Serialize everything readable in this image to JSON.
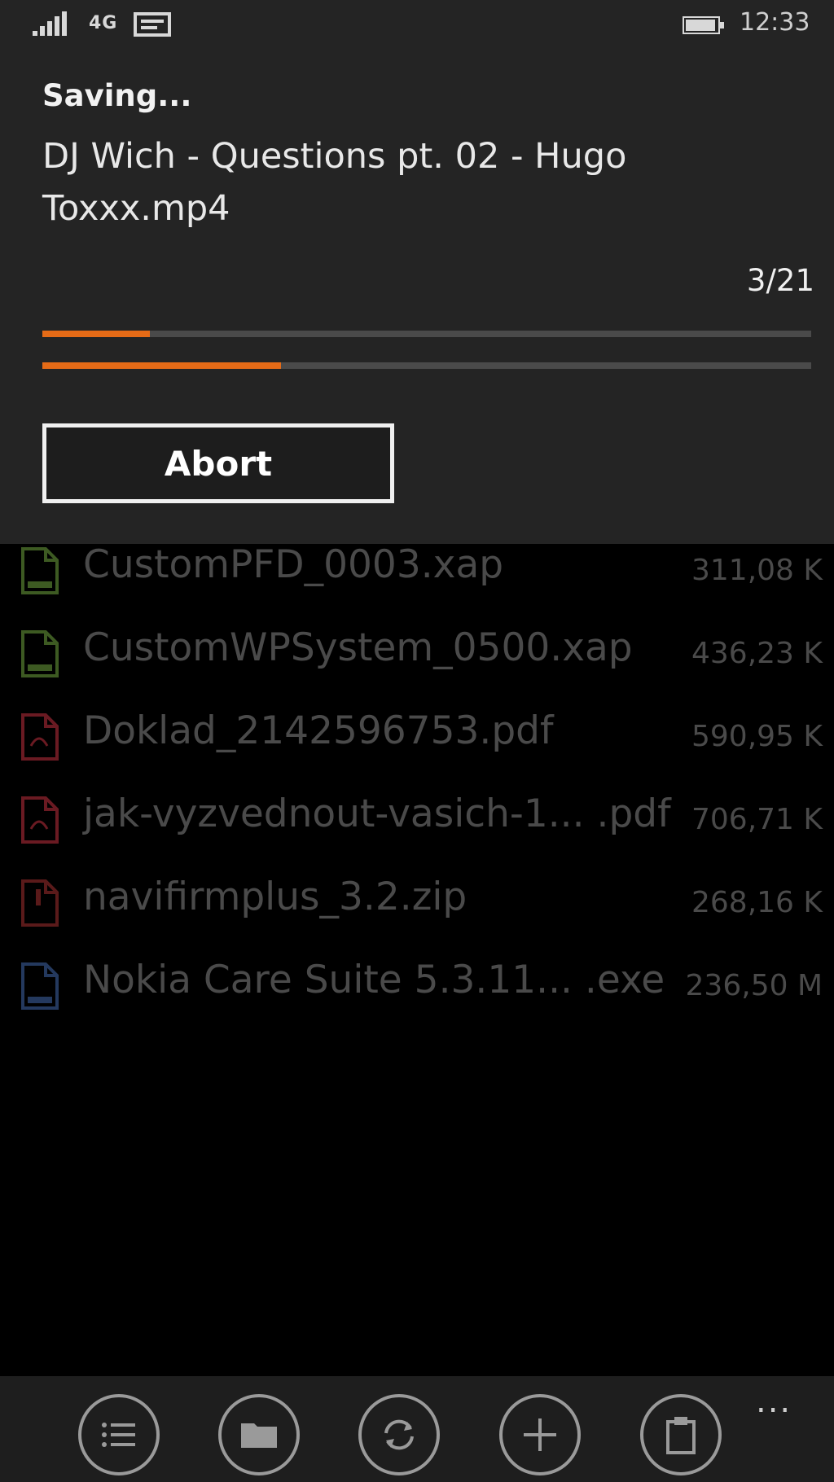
{
  "status_bar": {
    "network": "4G",
    "time": "12:33"
  },
  "dialog": {
    "title": "Saving...",
    "file_name": "DJ Wich - Questions pt. 02 - Hugo Toxxx.mp4",
    "counter": "3/21",
    "file_progress": 0.14,
    "total_progress": 0.31,
    "abort_label": "Abort",
    "accent_color": "#e56b17"
  },
  "files": [
    {
      "name": "CustomPFD_0003.xap",
      "size": "311,08 K",
      "icon": "xap-file-icon",
      "color": "#3d5a22"
    },
    {
      "name": "CustomWPSystem_0500.xap",
      "size": "436,23 K",
      "icon": "xap-file-icon",
      "color": "#3d5a22"
    },
    {
      "name": "Doklad_2142596753.pdf",
      "size": "590,95 K",
      "icon": "pdf-file-icon",
      "color": "#6a1a22"
    },
    {
      "name": "jak-vyzvednout-vasich-1... .pdf",
      "size": "706,71 K",
      "icon": "pdf-file-icon",
      "color": "#6a1a22"
    },
    {
      "name": "navifirmplus_3.2.zip",
      "size": "268,16 K",
      "icon": "zip-file-icon",
      "color": "#5a1a1a"
    },
    {
      "name": "Nokia Care Suite 5.3.11... .exe",
      "size": "236,50 M",
      "icon": "exe-file-icon",
      "color": "#24395e"
    }
  ],
  "app_bar": {
    "buttons": [
      "select-list-icon",
      "folder-icon",
      "sync-icon",
      "add-icon",
      "clipboard-icon"
    ],
    "more": "..."
  }
}
